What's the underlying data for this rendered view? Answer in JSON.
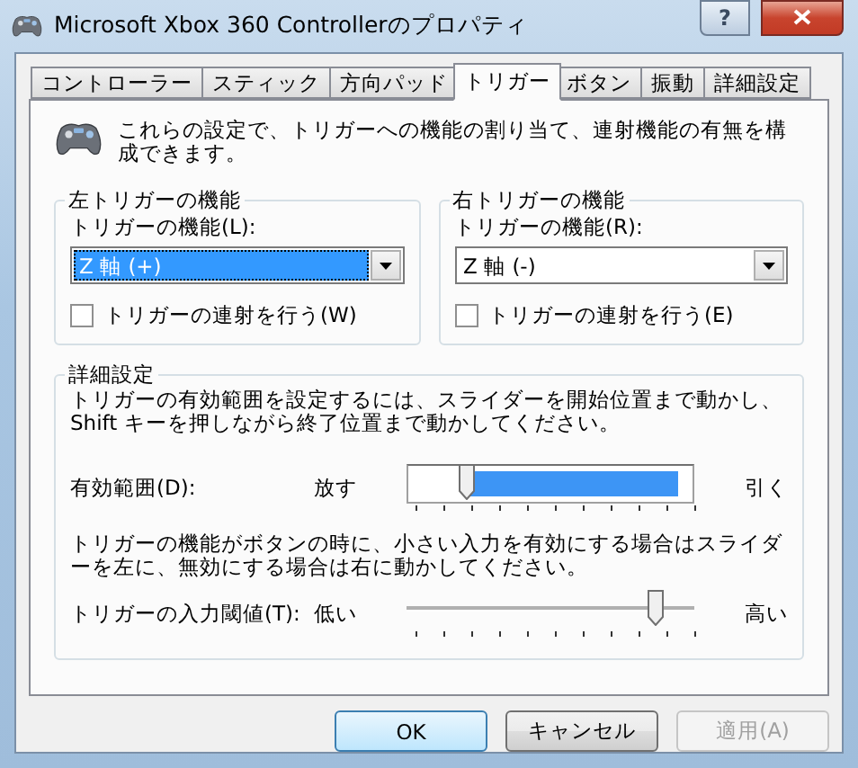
{
  "window": {
    "title": "Microsoft Xbox 360 Controllerのプロパティ",
    "help_label": "?"
  },
  "tabs": [
    {
      "label": "コントローラー",
      "selected": false
    },
    {
      "label": "スティック",
      "selected": false
    },
    {
      "label": "方向パッド",
      "selected": false
    },
    {
      "label": "トリガー",
      "selected": true
    },
    {
      "label": "ボタン",
      "selected": false
    },
    {
      "label": "振動",
      "selected": false
    },
    {
      "label": "詳細設定",
      "selected": false
    }
  ],
  "description": "これらの設定で、トリガーへの機能の割り当て、連射機能の有無を構成できます。",
  "trigger_groups": [
    {
      "title": "左トリガーの機能",
      "field_label": "トリガーの機能(L):",
      "value": "Z 軸 (+)",
      "focused": true,
      "checkbox": {
        "label": "トリガーの連射を行う(W)",
        "checked": false
      }
    },
    {
      "title": "右トリガーの機能",
      "field_label": "トリガーの機能(R):",
      "value": "Z 軸 (-)",
      "focused": false,
      "checkbox": {
        "label": "トリガーの連射を行う(E)",
        "checked": false
      }
    }
  ],
  "details": {
    "title": "詳細設定",
    "instruction": "トリガーの有効範囲を設定するには、スライダーを開始位置まで動かし、Shift キーを押しながら終了位置まで動かしてください。",
    "range": {
      "label": "有効範囲(D):",
      "low_label": "放す",
      "high_label": "引く",
      "level": 0.2
    },
    "threshold_text": "トリガーの機能がボタンの時に、小さい入力を有効にする場合はスライダーを左に、無効にする場合は右に動かしてください。",
    "threshold": {
      "label": "トリガーの入力閾値(T):",
      "low_label": "低い",
      "high_label": "高い",
      "level": 0.86
    }
  },
  "buttons": [
    {
      "label": "OK",
      "kind": "default",
      "disabled": false
    },
    {
      "label": "キャンセル",
      "kind": "normal",
      "disabled": false
    },
    {
      "label": "適用(A)",
      "kind": "normal",
      "disabled": true
    }
  ]
}
